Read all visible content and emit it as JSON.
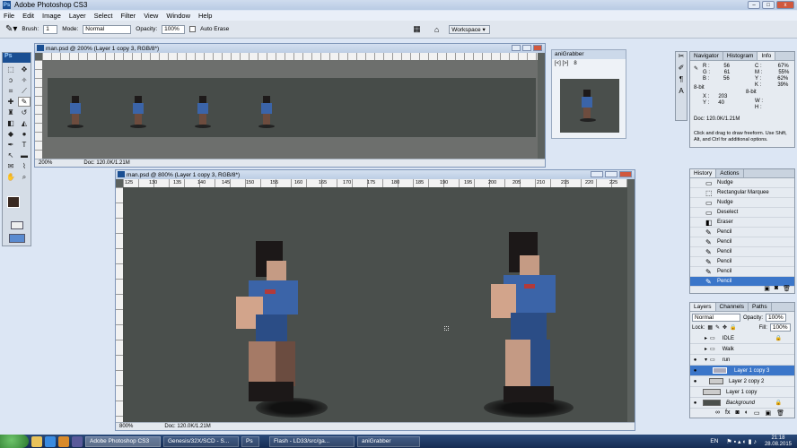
{
  "app": {
    "title": "Adobe Photoshop CS3",
    "ps_logo": "Ps"
  },
  "window_controls": {
    "minimize": "–",
    "maximize": "□",
    "close": "x"
  },
  "menu": [
    "File",
    "Edit",
    "Image",
    "Layer",
    "Select",
    "Filter",
    "View",
    "Window",
    "Help"
  ],
  "options_bar": {
    "brush_label": "Brush:",
    "brush_value": "1",
    "mode_label": "Mode:",
    "mode_value": "Normal",
    "opacity_label": "Opacity:",
    "opacity_value": "100%",
    "auto_erase": "Auto Erase",
    "workspace": "Workspace ▾"
  },
  "doc_small": {
    "title": "man.psd @ 200% (Layer 1 copy 3, RGB/8*)",
    "zoom": "200%",
    "doc_info": "Doc: 120.0K/1.21M"
  },
  "doc_large": {
    "title": "man.psd @ 800% (Layer 1 copy 3, RGB/8*)",
    "zoom": "800%",
    "doc_info": "Doc: 120.0K/1.21M",
    "ruler_labels": [
      "125",
      "130",
      "135",
      "140",
      "145",
      "150",
      "155",
      "160",
      "165",
      "170",
      "175",
      "180",
      "185",
      "190",
      "195",
      "200",
      "205",
      "210",
      "215",
      "220",
      "225"
    ]
  },
  "anigrabber": {
    "title": "aniGrabber",
    "frame": "8",
    "nav": "[<] [>]"
  },
  "info_panel": {
    "tabs": [
      "Navigator",
      "Histogram",
      "Info"
    ],
    "rgb": [
      [
        "R :",
        "56"
      ],
      [
        "G :",
        "61"
      ],
      [
        "B :",
        "56"
      ]
    ],
    "cmyk": [
      [
        "C :",
        "67%"
      ],
      [
        "M :",
        "55%"
      ],
      [
        "Y :",
        "62%"
      ],
      [
        "K :",
        "39%"
      ]
    ],
    "bit_left": "8-bit",
    "bit_right": "8-bit",
    "xy": [
      [
        "X :",
        "203"
      ],
      [
        "Y :",
        "40"
      ]
    ],
    "wh": [
      [
        "W :",
        ""
      ],
      [
        "H :",
        ""
      ]
    ],
    "doc": "Doc: 120.0K/1.21M",
    "hint": "Click and drag to draw freeform. Use Shift, Alt, and Ctrl for additional options."
  },
  "history_panel": {
    "tabs": [
      "History",
      "Actions"
    ],
    "items": [
      "Nudge",
      "Rectangular Marquee",
      "Nudge",
      "Deselect",
      "Eraser",
      "Pencil",
      "Pencil",
      "Pencil",
      "Pencil",
      "Pencil",
      "Pencil"
    ]
  },
  "layers_panel": {
    "tabs": [
      "Layers",
      "Channels",
      "Paths"
    ],
    "blend": "Normal",
    "opacity_label": "Opacity:",
    "opacity": "100%",
    "lock_label": "Lock:",
    "fill_label": "Fill:",
    "fill": "100%",
    "layers": [
      {
        "name": "IDLE",
        "type": "group",
        "visible": false,
        "selected": false
      },
      {
        "name": "Walk",
        "type": "group",
        "visible": false,
        "selected": false
      },
      {
        "name": "run",
        "type": "group",
        "visible": true,
        "selected": false
      },
      {
        "name": "Layer 1 copy 3",
        "type": "layer",
        "visible": true,
        "selected": true
      },
      {
        "name": "Layer 2 copy 2",
        "type": "layer",
        "visible": true,
        "selected": false
      },
      {
        "name": "Layer 1 copy",
        "type": "layer",
        "visible": false,
        "selected": false
      },
      {
        "name": "Background",
        "type": "layer",
        "visible": true,
        "selected": false
      }
    ]
  },
  "taskbar": {
    "buttons": [
      "Adobe Photoshop CS3",
      "Genesis/32X/SCD - S...",
      "Ps",
      "Flash - LD33/src/ga...",
      "aniGrabber"
    ],
    "lang": "EN",
    "time": "21:18",
    "date": "28.08.2015"
  }
}
